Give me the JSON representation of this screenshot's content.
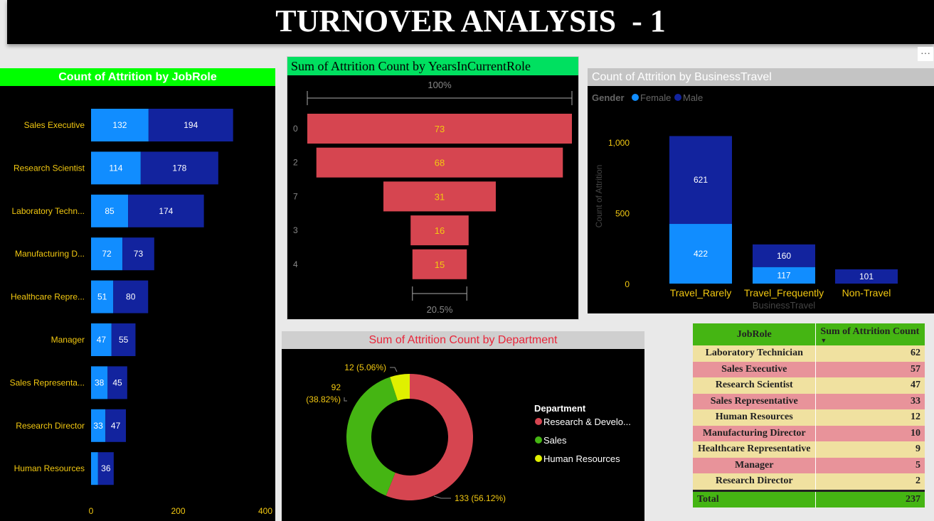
{
  "header": {
    "title": "TURNOVER ANALYSIS  - 1",
    "more_label": "···"
  },
  "colors": {
    "female": "#118dff",
    "male": "#12239e",
    "funnel": "#d64550",
    "dept_rd": "#d64550",
    "dept_sales": "#45b513",
    "dept_hr": "#e0f000",
    "table_header": "#45b513"
  },
  "chart_data": [
    {
      "id": "jobrole",
      "type": "bar",
      "title": "Count of Attrition by JobRole",
      "orientation": "horizontal",
      "stacked": true,
      "categories": [
        "Sales Executive",
        "Research Scientist",
        "Laboratory Techn...",
        "Manufacturing D...",
        "Healthcare Repre...",
        "Manager",
        "Sales Representa...",
        "Research Director",
        "Human Resources"
      ],
      "series": [
        {
          "color": "#118dff",
          "values": [
            132,
            114,
            85,
            72,
            51,
            47,
            38,
            33,
            16
          ]
        },
        {
          "color": "#12239e",
          "values": [
            194,
            178,
            174,
            73,
            80,
            55,
            45,
            47,
            36
          ]
        }
      ],
      "data_labels": [
        [
          "132",
          "114",
          "85",
          "72",
          "51",
          "47",
          "38",
          "33",
          ""
        ],
        [
          "194",
          "178",
          "174",
          "73",
          "80",
          "55",
          "45",
          "47",
          "36"
        ]
      ],
      "xlim": [
        0,
        400
      ],
      "xticks": [
        "0",
        "200",
        "400"
      ]
    },
    {
      "id": "years",
      "type": "funnel",
      "title": "Sum of Attrition Count by YearsInCurrentRole",
      "categories": [
        "0",
        "2",
        "7",
        "3",
        "4"
      ],
      "values": [
        73,
        68,
        31,
        16,
        15
      ],
      "top_label": "100%",
      "bottom_label": "20.5%"
    },
    {
      "id": "travel",
      "type": "bar",
      "title": "Count of Attrition by BusinessTravel",
      "stacked": true,
      "legend_title": "Gender",
      "legend_placement": "top-left",
      "categories": [
        "Travel_Rarely",
        "Travel_Frequently",
        "Non-Travel"
      ],
      "series": [
        {
          "name": "Female",
          "color": "#118dff",
          "values": [
            422,
            117,
            0
          ]
        },
        {
          "name": "Male",
          "color": "#12239e",
          "values": [
            621,
            160,
            101
          ]
        }
      ],
      "ylim": [
        0,
        1000
      ],
      "yticks": [
        "0",
        "500",
        "1,000"
      ],
      "xlabel": "BusinessTravel",
      "ylabel": "Count of Attrition"
    },
    {
      "id": "dept",
      "type": "pie",
      "donut": true,
      "title": "Sum of Attrition Count by Department",
      "legend_title": "Department",
      "legend_placement": "right",
      "categories": [
        "Research & Develo...",
        "Sales",
        "Human Resources"
      ],
      "values": [
        133,
        92,
        12
      ],
      "colors": [
        "#d64550",
        "#45b513",
        "#e0f000"
      ],
      "data_labels": [
        "133 (56.12%)",
        "92 (38.82%)",
        "12 (5.06%)"
      ]
    },
    {
      "id": "table",
      "type": "table",
      "columns": [
        "JobRole",
        "Sum of Attrition Count"
      ],
      "rows": [
        [
          "Laboratory Technician",
          "62"
        ],
        [
          "Sales Executive",
          "57"
        ],
        [
          "Research Scientist",
          "47"
        ],
        [
          "Sales Representative",
          "33"
        ],
        [
          "Human Resources",
          "12"
        ],
        [
          "Manufacturing Director",
          "10"
        ],
        [
          "Healthcare Representative",
          "9"
        ],
        [
          "Manager",
          "5"
        ],
        [
          "Research Director",
          "2"
        ]
      ],
      "total": [
        "Total",
        "237"
      ]
    }
  ]
}
